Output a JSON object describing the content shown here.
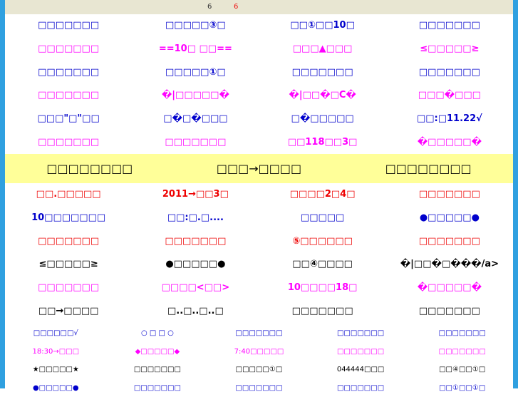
{
  "header": {
    "count_a": "6",
    "count_b": "6"
  },
  "section1": [
    [
      {
        "text": "□□□□□□□",
        "c": "blue"
      },
      {
        "text": "□□□□□③□",
        "c": "blue"
      },
      {
        "text": "□□①□□10□",
        "c": "blue"
      },
      {
        "text": "□□□□□□□",
        "c": "blue"
      }
    ],
    [
      {
        "text": "□□□□□□□",
        "c": "mag"
      },
      {
        "text": "==10□ □□==",
        "c": "mag"
      },
      {
        "text": "□□□▲□□□",
        "c": "mag"
      },
      {
        "text": "≤□□□□□≥",
        "c": "mag"
      }
    ],
    [
      {
        "text": "□□□□□□□",
        "c": "blue"
      },
      {
        "text": "□□□□□①□",
        "c": "blue"
      },
      {
        "text": "□□□□□□□",
        "c": "blue"
      },
      {
        "text": "□□□□□□□",
        "c": "blue"
      }
    ],
    [
      {
        "text": "□□□□□□□",
        "c": "mag"
      },
      {
        "text": "�|□□□□□�",
        "c": "mag"
      },
      {
        "text": "�|□□�□C�",
        "c": "mag"
      },
      {
        "text": "□□□�□□□",
        "c": "mag"
      }
    ],
    [
      {
        "text": "□□□\"□\"□□",
        "c": "blue"
      },
      {
        "text": "□�□�□□□",
        "c": "blue"
      },
      {
        "text": "□�□□□□□",
        "c": "blue"
      },
      {
        "text": "□□:□11.22√",
        "c": "blue"
      }
    ],
    [
      {
        "text": "□□□□□□□",
        "c": "mag"
      },
      {
        "text": "□□□□□□□",
        "c": "mag"
      },
      {
        "text": "□□118□□3□",
        "c": "mag"
      },
      {
        "text": "�□□□□□�",
        "c": "mag"
      }
    ]
  ],
  "banner": [
    "□□□□□□□□",
    "□□□→□□□□",
    "□□□□□□□□"
  ],
  "section2": [
    [
      {
        "text": "□□.□□□□□",
        "c": "red"
      },
      {
        "text": "2011→□□3□",
        "c": "red"
      },
      {
        "text": "□□□□2□4□",
        "c": "red"
      },
      {
        "text": "□□□□□□□",
        "c": "red"
      }
    ],
    [
      {
        "text": "10□□□□□□□",
        "c": "blue"
      },
      {
        "text": "□□:□.□....",
        "c": "blue"
      },
      {
        "text": "□□□□□",
        "c": "blue"
      },
      {
        "text": "●□□□□□●",
        "c": "blue"
      }
    ],
    [
      {
        "text": "□□□□□□□",
        "c": "red"
      },
      {
        "text": "□□□□□□□",
        "c": "red"
      },
      {
        "text": "⑤□□□□□□",
        "c": "red"
      },
      {
        "text": "□□□□□□□",
        "c": "red"
      }
    ],
    [
      {
        "text": "≤□□□□□≥",
        "c": "blk"
      },
      {
        "text": "●□□□□□●",
        "c": "blk"
      },
      {
        "text": "□□④□□□□",
        "c": "blk"
      },
      {
        "text": "�|□□�□���/a>",
        "c": "blk"
      }
    ],
    [
      {
        "text": "□□□□□□□",
        "c": "mag"
      },
      {
        "text": "□□□□<□□>",
        "c": "mag"
      },
      {
        "text": "10□□□□18□",
        "c": "mag"
      },
      {
        "text": "�□□□□□�",
        "c": "mag"
      }
    ],
    [
      {
        "text": "□□→□□□□",
        "c": "blk"
      },
      {
        "text": "□..□..□..□",
        "c": "blk"
      },
      {
        "text": "□□□□□□□",
        "c": "blk"
      },
      {
        "text": "□□□□□□□",
        "c": "blk"
      }
    ]
  ],
  "section3": [
    [
      {
        "text": "□□□□□□√",
        "c": "blue"
      },
      {
        "text": "○ □ □ ○",
        "c": "blue"
      },
      {
        "text": "□□□□□□□",
        "c": "blue"
      },
      {
        "text": "□□□□□□□",
        "c": "blue"
      },
      {
        "text": "□□□□□□□",
        "c": "blue"
      }
    ],
    [
      {
        "text": "18:30→□□□",
        "c": "mag"
      },
      {
        "text": "◆□□□□□◆",
        "c": "mag"
      },
      {
        "text": "7:40□□□□□",
        "c": "mag"
      },
      {
        "text": "□□□□□□□",
        "c": "mag"
      },
      {
        "text": "□□□□□□□",
        "c": "mag"
      }
    ],
    [
      {
        "text": "★□□□□□★",
        "c": "blk"
      },
      {
        "text": "□□□□□□□",
        "c": "blk"
      },
      {
        "text": "□□□□□①□",
        "c": "blk"
      },
      {
        "text": "044444□□□",
        "c": "blk"
      },
      {
        "text": "□□④□□①□",
        "c": "blk"
      }
    ],
    [
      {
        "text": "●□□□□□●",
        "c": "blue"
      },
      {
        "text": "□□□□□□□",
        "c": "blue"
      },
      {
        "text": "□□□□□□□",
        "c": "blue"
      },
      {
        "text": "□□□□□□□",
        "c": "blue"
      },
      {
        "text": "□□①□□①□",
        "c": "blue"
      }
    ]
  ]
}
